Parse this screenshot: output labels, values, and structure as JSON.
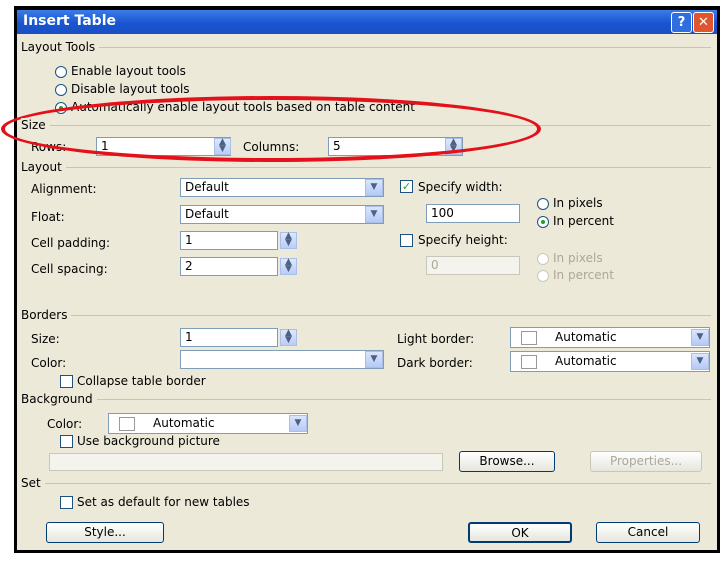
{
  "window": {
    "title": "Insert Table",
    "help_icon": "question-mark-icon",
    "close_icon": "close-x-icon"
  },
  "layout_tools": {
    "group": "Layout Tools",
    "enable": "Enable layout tools",
    "disable": "Disable layout tools",
    "auto": "Automatically enable layout tools based on table content"
  },
  "size": {
    "group": "Size",
    "rows_label": "Rows:",
    "rows_value": "1",
    "columns_label": "Columns:",
    "columns_value": "5"
  },
  "layout": {
    "group": "Layout",
    "alignment_label": "Alignment:",
    "alignment_value": "Default",
    "float_label": "Float:",
    "float_value": "Default",
    "cell_padding_label": "Cell padding:",
    "cell_padding_value": "1",
    "cell_spacing_label": "Cell spacing:",
    "cell_spacing_value": "2",
    "specify_width": "Specify width:",
    "width_value": "100",
    "in_pixels": "In pixels",
    "in_percent": "In percent",
    "specify_height": "Specify height:",
    "height_value": "0",
    "in_pixels_h": "In pixels",
    "in_percent_h": "In percent"
  },
  "borders": {
    "group": "Borders",
    "size_label": "Size:",
    "size_value": "1",
    "color_label": "Color:",
    "color_value": "",
    "light_label": "Light border:",
    "light_value": "Automatic",
    "dark_label": "Dark border:",
    "dark_value": "Automatic",
    "collapse": "Collapse table border"
  },
  "background": {
    "group": "Background",
    "color_label": "Color:",
    "color_value": "Automatic",
    "use_picture": "Use background picture",
    "picture_path": "",
    "browse": "Browse...",
    "properties": "Properties..."
  },
  "set": {
    "group": "Set",
    "default": "Set as default for new tables"
  },
  "buttons": {
    "style": "Style...",
    "ok": "OK",
    "cancel": "Cancel"
  },
  "colors": {
    "title_bar": "#1955d0",
    "dialog_bg": "#ece9d8",
    "annotation": "#e4101a"
  }
}
